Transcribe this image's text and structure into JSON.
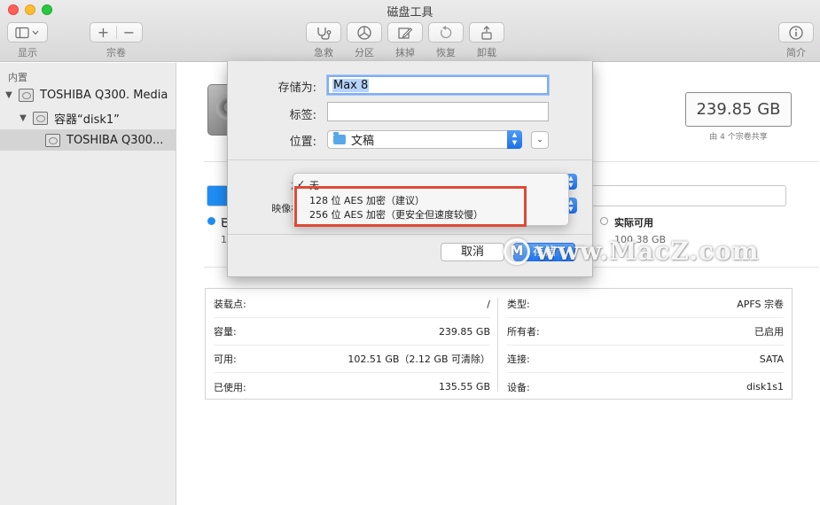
{
  "window": {
    "title": "磁盘工具"
  },
  "toolbar": {
    "display_label": "显示",
    "volume_label": "宗卷",
    "add_glyph": "+",
    "remove_glyph": "−",
    "first_aid_label": "急救",
    "partition_label": "分区",
    "erase_label": "抹掉",
    "restore_label": "恢复",
    "unmount_label": "卸载",
    "info_label": "简介"
  },
  "sidebar": {
    "section_header": "内置",
    "items": [
      {
        "label": "TOSHIBA Q300. Media",
        "disclosure": "▼"
      },
      {
        "label": "容器“disk1”",
        "disclosure": "▼"
      },
      {
        "label": "TOSHIBA Q300...",
        "disclosure": "",
        "selected": true
      }
    ]
  },
  "main": {
    "capacity": "239.85 GB",
    "shared_note": "由 4 个宗卷共享",
    "legend": {
      "used_label": "已",
      "used_value": "13",
      "free_label": "实际可用",
      "free_value": "100.38 GB"
    },
    "usage_fraction": 0.06,
    "info_left": [
      {
        "key": "装载点:",
        "value": "/"
      },
      {
        "key": "容量:",
        "value": "239.85 GB"
      },
      {
        "key": "可用:",
        "value": "102.51 GB（2.12 GB 可清除）"
      },
      {
        "key": "已使用:",
        "value": "135.55 GB"
      }
    ],
    "info_right": [
      {
        "key": "类型:",
        "value": "APFS 宗卷"
      },
      {
        "key": "所有者:",
        "value": "已启用"
      },
      {
        "key": "连接:",
        "value": "SATA"
      },
      {
        "key": "设备:",
        "value": "disk1s1"
      }
    ]
  },
  "sheet": {
    "save_as_label": "存储为:",
    "save_as_value": "Max 8",
    "tags_label": "标签:",
    "tags_value": "",
    "location_label": "位置:",
    "location_value": "文稿",
    "expand_glyph": "⌄",
    "encryption_label": "加密:",
    "image_format_label": "映像格式:",
    "cancel_label": "取消",
    "save_label": "存储"
  },
  "encryption_menu": {
    "checkmark": "✓",
    "items": [
      "无",
      "128 位 AES 加密（建议）",
      "256 位 AES 加密（更安全但速度较慢）"
    ]
  },
  "watermark": {
    "text": "www.MacZ.com"
  },
  "colors": {
    "accent": "#1e8ef5",
    "highlight": "#de4a36"
  }
}
